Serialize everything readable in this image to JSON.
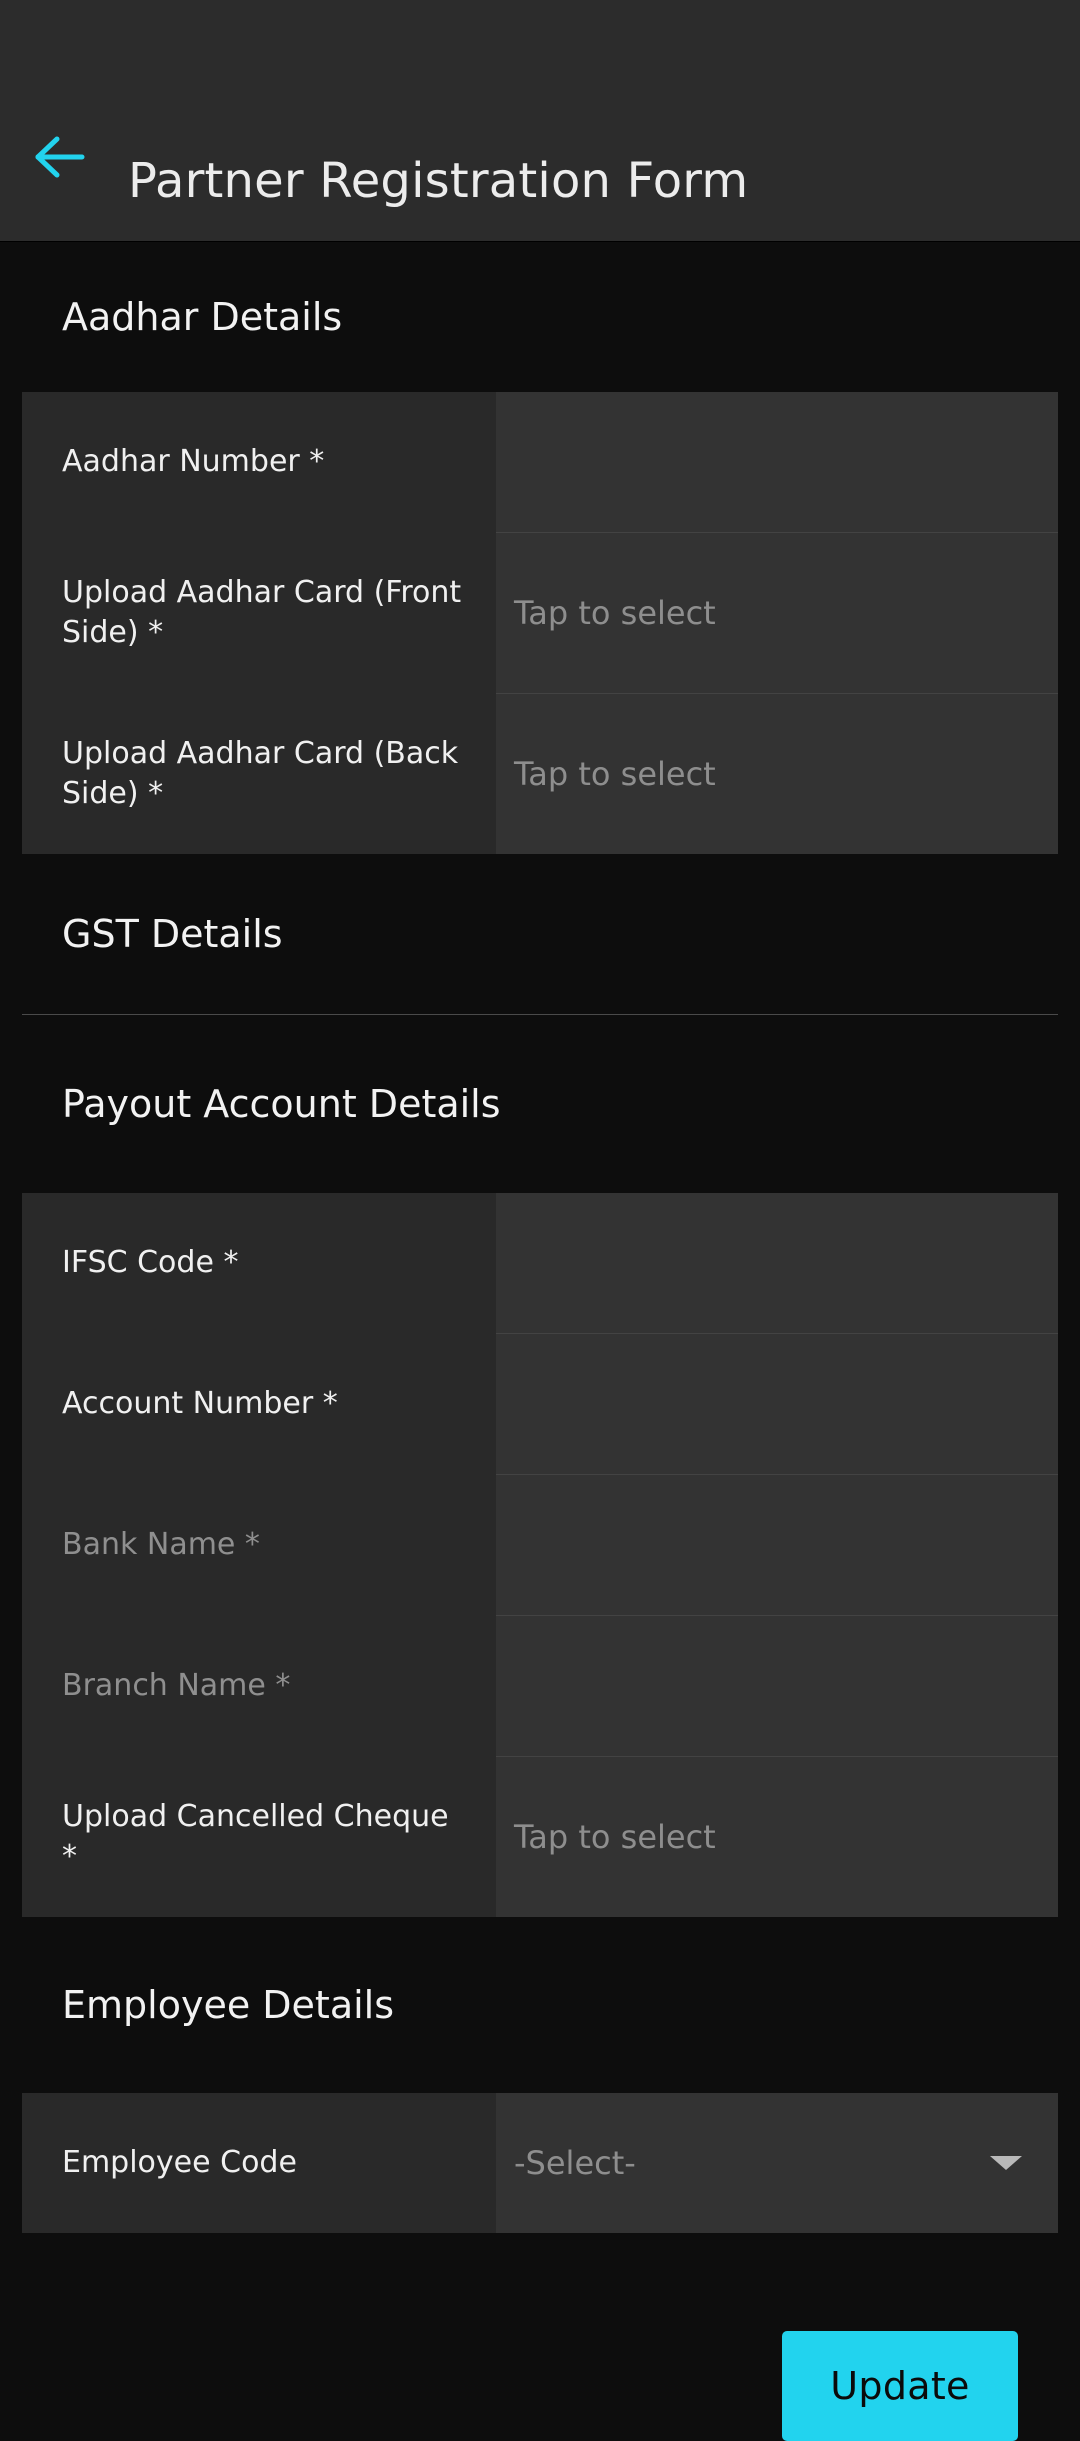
{
  "appbar": {
    "back_icon": "arrow-left-icon",
    "title": "Partner Registration Form",
    "accent_color": "#22d3ee",
    "background_color": "#2c2c2c"
  },
  "theme": {
    "page_background": "#0d0d0d",
    "label_cell_background": "#292929",
    "value_cell_background": "#333333",
    "text_primary": "#f0f0f0",
    "text_dim": "#8e8e8e",
    "accent": "#22d3ee"
  },
  "sections": {
    "aadhar": {
      "title": "Aadhar Details",
      "rows": [
        {
          "label": "Aadhar Number *",
          "type": "text",
          "value": "",
          "placeholder": ""
        },
        {
          "label": "Upload Aadhar Card (Front Side) *",
          "type": "file",
          "value": "",
          "placeholder": "Tap to select"
        },
        {
          "label": "Upload Aadhar Card (Back Side) *",
          "type": "file",
          "value": "",
          "placeholder": "Tap to select"
        }
      ]
    },
    "gst": {
      "title": "GST Details",
      "rows": []
    },
    "payout": {
      "title": "Payout Account Details",
      "rows": [
        {
          "label": "IFSC Code *",
          "type": "text",
          "value": "",
          "placeholder": ""
        },
        {
          "label": "Account Number *",
          "type": "text",
          "value": "",
          "placeholder": ""
        },
        {
          "label": "Bank Name *",
          "type": "text",
          "value": "",
          "placeholder": "",
          "disabled": true
        },
        {
          "label": "Branch Name *",
          "type": "text",
          "value": "",
          "placeholder": "",
          "disabled": true
        },
        {
          "label": "Upload Cancelled Cheque *",
          "type": "file",
          "value": "",
          "placeholder": "Tap to select"
        }
      ]
    },
    "employee": {
      "title": "Employee Details",
      "rows": [
        {
          "label": "Employee Code",
          "type": "select",
          "value": "-Select-",
          "caret_icon": "chevron-down-icon"
        }
      ]
    }
  },
  "footer": {
    "update_label": "Update"
  }
}
